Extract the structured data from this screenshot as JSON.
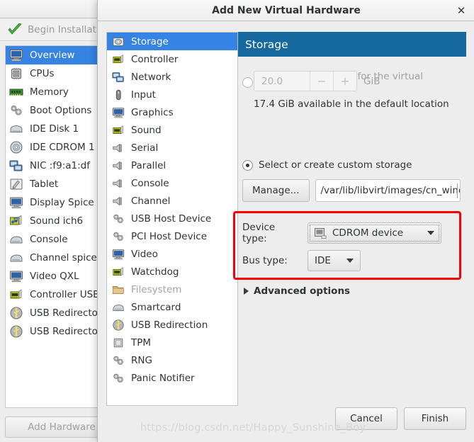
{
  "background_window": {
    "toolbar": {
      "icon": "green-check-icon",
      "begin_installation_label": "Begin Installati"
    },
    "hardware_list": [
      {
        "label": "Overview",
        "icon": "monitor-icon",
        "selected": true
      },
      {
        "label": "CPUs",
        "icon": "cpu-icon",
        "selected": false
      },
      {
        "label": "Memory",
        "icon": "memory-icon",
        "selected": false
      },
      {
        "label": "Boot Options",
        "icon": "gears-icon",
        "selected": false
      },
      {
        "label": "IDE Disk 1",
        "icon": "harddisk-icon",
        "selected": false
      },
      {
        "label": "IDE CDROM 1",
        "icon": "cdrom-disc-icon",
        "selected": false
      },
      {
        "label": "NIC :f9:a1:df",
        "icon": "network-icon",
        "selected": false
      },
      {
        "label": "Tablet",
        "icon": "tablet-pen-icon",
        "selected": false
      },
      {
        "label": "Display Spice",
        "icon": "display-icon",
        "selected": false
      },
      {
        "label": "Sound ich6",
        "icon": "sound-icon",
        "selected": false
      },
      {
        "label": "Console",
        "icon": "console-icon",
        "selected": false
      },
      {
        "label": "Channel spice",
        "icon": "console-icon",
        "selected": false
      },
      {
        "label": "Video QXL",
        "icon": "display-icon",
        "selected": false
      },
      {
        "label": "Controller USB",
        "icon": "controller-icon",
        "selected": false
      },
      {
        "label": "USB Redirecto",
        "icon": "usb-icon",
        "selected": false
      },
      {
        "label": "USB Redirecto",
        "icon": "usb-icon",
        "selected": false
      }
    ],
    "add_hardware_label": "Add Hardware"
  },
  "dialog": {
    "title": "Add New Virtual Hardware",
    "close_icon": "close-icon",
    "device_list": [
      {
        "label": "Storage",
        "icon": "storage-icon",
        "selected": true,
        "disabled": false
      },
      {
        "label": "Controller",
        "icon": "controller-icon",
        "selected": false,
        "disabled": false
      },
      {
        "label": "Network",
        "icon": "network-icon",
        "selected": false,
        "disabled": false
      },
      {
        "label": "Input",
        "icon": "mouse-icon",
        "selected": false,
        "disabled": false
      },
      {
        "label": "Graphics",
        "icon": "display-icon",
        "selected": false,
        "disabled": false
      },
      {
        "label": "Sound",
        "icon": "controller-icon",
        "selected": false,
        "disabled": false
      },
      {
        "label": "Serial",
        "icon": "port-icon",
        "selected": false,
        "disabled": false
      },
      {
        "label": "Parallel",
        "icon": "port-icon",
        "selected": false,
        "disabled": false
      },
      {
        "label": "Console",
        "icon": "port-icon",
        "selected": false,
        "disabled": false
      },
      {
        "label": "Channel",
        "icon": "port-icon",
        "selected": false,
        "disabled": false
      },
      {
        "label": "USB Host Device",
        "icon": "gears-icon",
        "selected": false,
        "disabled": false
      },
      {
        "label": "PCI Host Device",
        "icon": "gears-icon",
        "selected": false,
        "disabled": false
      },
      {
        "label": "Video",
        "icon": "display-icon",
        "selected": false,
        "disabled": false
      },
      {
        "label": "Watchdog",
        "icon": "controller-icon",
        "selected": false,
        "disabled": false
      },
      {
        "label": "Filesystem",
        "icon": "folder-icon",
        "selected": false,
        "disabled": true
      },
      {
        "label": "Smartcard",
        "icon": "console-icon",
        "selected": false,
        "disabled": false
      },
      {
        "label": "USB Redirection",
        "icon": "usb-icon",
        "selected": false,
        "disabled": false
      },
      {
        "label": "TPM",
        "icon": "chip-icon",
        "selected": false,
        "disabled": false
      },
      {
        "label": "RNG",
        "icon": "gears-icon",
        "selected": false,
        "disabled": false
      },
      {
        "label": "Panic Notifier",
        "icon": "gears-icon",
        "selected": false,
        "disabled": false
      }
    ],
    "panel": {
      "header": "Storage",
      "header_color": "#15699e",
      "create_disk_radio_label": "Create a disk image for the virtual machine",
      "create_disk_selected": false,
      "disk_size_value": "20.0",
      "spin_minus": "−",
      "spin_plus": "+",
      "size_unit": "GiB",
      "available_note": "17.4 GiB available in the default location",
      "custom_storage_radio_label": "Select or create custom storage",
      "custom_storage_selected": true,
      "manage_button": "Manage...",
      "path_value": "/var/lib/libvirt/images/cn_windo",
      "device_type_label": "Device type:",
      "device_type_value": "CDROM device",
      "device_type_icon": "cdrom-device-icon",
      "bus_type_label": "Bus type:",
      "bus_type_value": "IDE",
      "advanced_options_label": "Advanced options",
      "advanced_expander_icon": "triangle-right-icon",
      "highlight_color": "#fb0000"
    },
    "footer": {
      "cancel_label": "Cancel",
      "finish_label": "Finish"
    }
  },
  "watermark": "https://blog.csdn.net/Happy_Sunshine_Boy"
}
